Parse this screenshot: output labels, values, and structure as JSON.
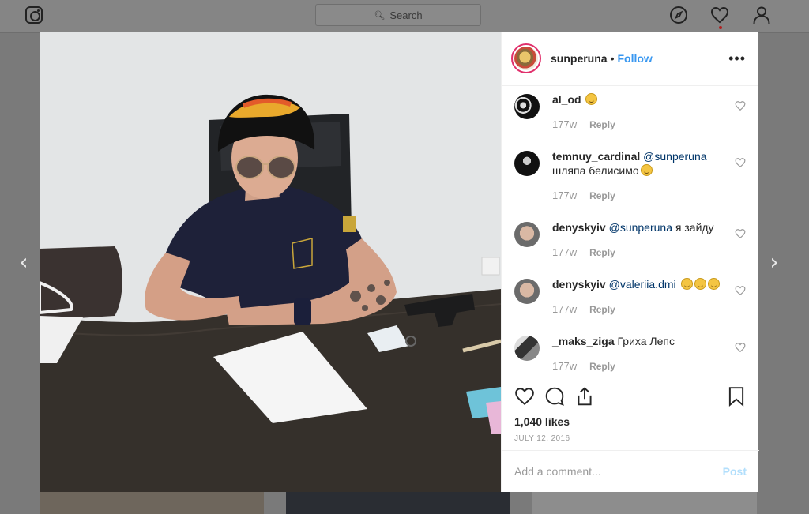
{
  "nav": {
    "search_placeholder": "Search",
    "icons": [
      "instagram-logo",
      "compass-icon",
      "heart-icon",
      "person-icon"
    ]
  },
  "post": {
    "username": "sunperuna",
    "separator": "•",
    "follow_label": "Follow",
    "more_label": "•••",
    "likes": "1,040 likes",
    "date": "JULY 12, 2016",
    "comment_placeholder": "Add a comment...",
    "post_label": "Post"
  },
  "comments": [
    {
      "user": "al_od",
      "mention": "",
      "text": "",
      "emoji_count": 1,
      "time": "177w",
      "reply": "Reply"
    },
    {
      "user": "temnuy_cardinal",
      "mention": "@sunperuna",
      "text": "шляпа белисимо",
      "emoji_count": 1,
      "time": "177w",
      "reply": "Reply"
    },
    {
      "user": "denyskyiv",
      "mention": "@sunperuna",
      "text": "я зайду",
      "emoji_count": 0,
      "time": "177w",
      "reply": "Reply"
    },
    {
      "user": "denyskyiv",
      "mention": "@valeriia.dmi",
      "text": "",
      "emoji_count": 3,
      "time": "177w",
      "reply": "Reply"
    },
    {
      "user": "_maks_ziga",
      "mention": "",
      "text": "Гриха Лепс",
      "emoji_count": 0,
      "time": "177w",
      "reply": "Reply"
    }
  ],
  "arrows": {
    "prev": "‹",
    "next": "›"
  }
}
